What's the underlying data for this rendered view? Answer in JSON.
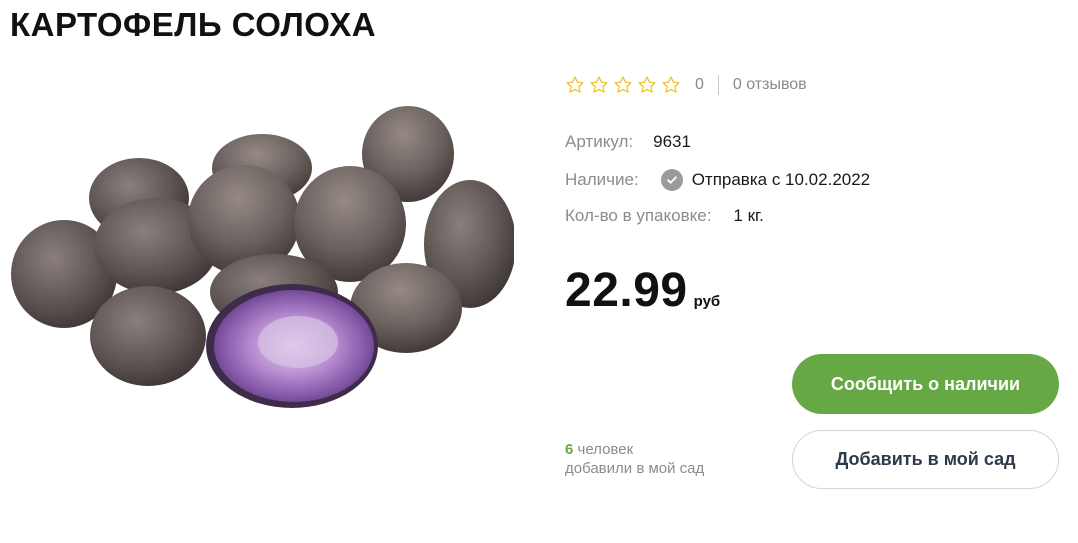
{
  "product": {
    "title": "КАРТОФЕЛЬ СОЛОХА",
    "image_alt": "potato-photo"
  },
  "rating": {
    "stars_filled": 0,
    "stars_total": 5,
    "count": "0",
    "reviews_label": "0 отзывов"
  },
  "specs": {
    "sku_label": "Артикул:",
    "sku_value": "9631",
    "availability_label": "Наличие:",
    "availability_value": "Отправка с 10.02.2022",
    "package_label": "Кол-во в упаковке:",
    "package_value": "1 кг."
  },
  "price": {
    "value": "22.99",
    "currency": "руб"
  },
  "actions": {
    "notify_label": "Сообщить о наличии",
    "add_garden_label": "Добавить в мой сад"
  },
  "garden": {
    "count": "6",
    "line1_suffix": " человек",
    "line2": "добавили в мой сад"
  },
  "colors": {
    "accent_green": "#66a944",
    "star_outline": "#f2c230",
    "muted_text": "#8c8c8c"
  },
  "icons": {
    "rating_star": "star-outline-icon",
    "availability": "check-circle-icon"
  }
}
